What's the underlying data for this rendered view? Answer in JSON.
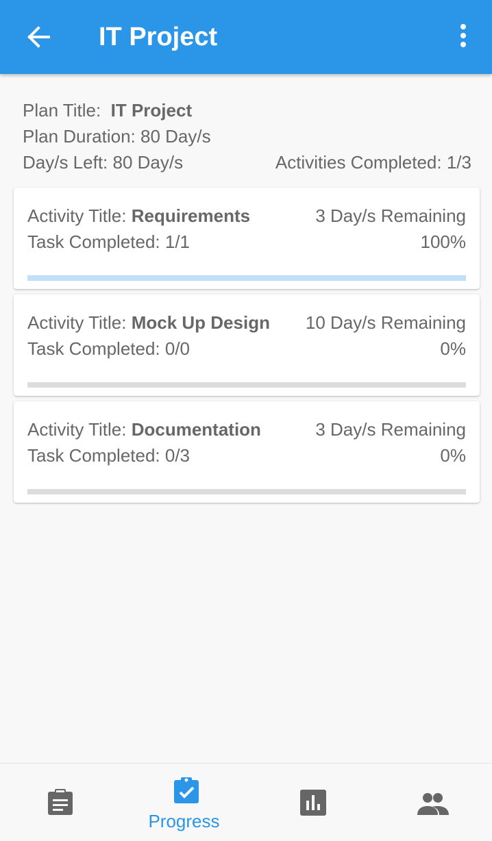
{
  "app_bar": {
    "title": "IT Project",
    "background_color": "#2b95e8",
    "back_icon": "arrow-back-icon",
    "menu_icon": "more-vert-icon"
  },
  "plan": {
    "title_label": "Plan Title:",
    "title_value": "IT Project",
    "duration_text": "Plan Duration: 80 Day/s",
    "days_left_text": "Day/s Left: 80 Day/s",
    "activities_completed_text": "Activities Completed: 1/3"
  },
  "activities": [
    {
      "title_label": "Activity Title:",
      "title_value": "Requirements",
      "remaining": "3 Day/s Remaining",
      "tasks_text": "Task Completed: 1/1",
      "percent_text": "100%",
      "progress": 1.0
    },
    {
      "title_label": "Activity Title:",
      "title_value": "Mock Up Design",
      "remaining": "10 Day/s Remaining",
      "tasks_text": "Task Completed: 0/0",
      "percent_text": "0%",
      "progress": 0.0
    },
    {
      "title_label": "Activity Title:",
      "title_value": "Documentation",
      "remaining": "3 Day/s Remaining",
      "tasks_text": "Task Completed: 0/3",
      "percent_text": "0%",
      "progress": 0.0
    }
  ],
  "bottom_nav": {
    "active_color": "#2b95e8",
    "inactive_color": "#666666",
    "items": [
      {
        "icon": "clipboard-icon",
        "label": ""
      },
      {
        "icon": "clipboard-check-icon",
        "label": "Progress"
      },
      {
        "icon": "bar-chart-icon",
        "label": ""
      },
      {
        "icon": "people-icon",
        "label": ""
      }
    ]
  }
}
